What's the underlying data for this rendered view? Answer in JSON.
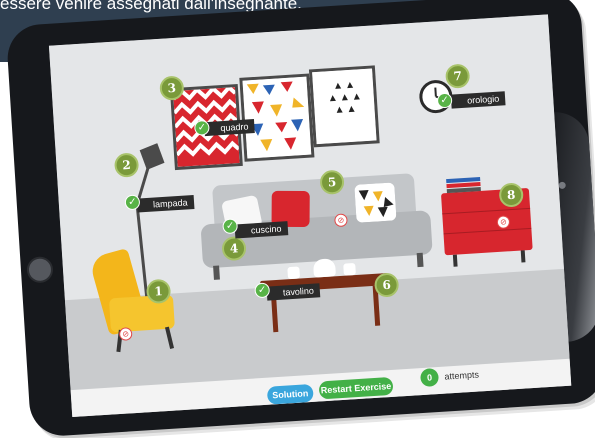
{
  "banner": {
    "text": "essere venire assegnati dall'insegnante."
  },
  "colors": {
    "wall": "#e4e6e8",
    "marker": "#7a9a3a",
    "check": "#58b347",
    "sofa": "#b9bcbf",
    "sideboard": "#d7262e"
  },
  "markers": [
    "1",
    "2",
    "3",
    "4",
    "5",
    "6",
    "7",
    "8"
  ],
  "labels": {
    "quadro": "quadro",
    "orologio": "orologio",
    "lampada": "lampada",
    "cuscino": "cuscino",
    "tavolino": "tavolino"
  },
  "icons": {
    "check": "✓",
    "not_allowed": "⊘"
  },
  "footer": {
    "solution_label": "Solution",
    "restart_label": "Restart Exercise",
    "attempts_count": "0",
    "attempts_label": "attempts"
  }
}
